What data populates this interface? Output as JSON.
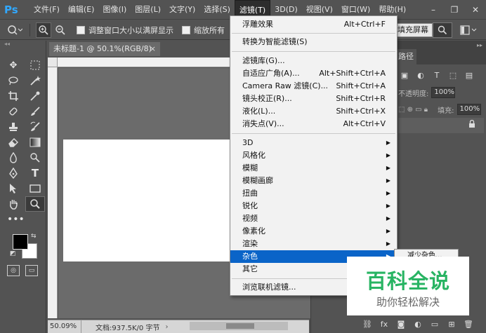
{
  "app": {
    "logo": "Ps"
  },
  "menubar": {
    "items": [
      "文件(F)",
      "编辑(E)",
      "图像(I)",
      "图层(L)",
      "文字(Y)",
      "选择(S)",
      "滤镜(T)",
      "3D(D)",
      "视图(V)",
      "窗口(W)",
      "帮助(H)"
    ],
    "active_index": 6
  },
  "window_controls": {
    "minimize": "–",
    "restore": "❐",
    "close": "✕"
  },
  "options": {
    "resize_windows_label": "调整窗口大小以满屏显示",
    "zoom_all_label": "缩放所有",
    "fill_screen_label": "填充屏幕"
  },
  "document": {
    "tab_title": "未标题-1 @ 50.1%(RGB/8)",
    "tab_close": "×"
  },
  "status": {
    "zoom": "50.09%",
    "info": "文档:937.5K/0 字节",
    "arrow": "›"
  },
  "panel": {
    "tab_label": "路径",
    "opacity_label": "不透明度:",
    "opacity_value": "100%",
    "fill_label": "填充:",
    "fill_value": "100%"
  },
  "filter_menu": {
    "items": [
      {
        "label": "浮雕效果",
        "shortcut": "Alt+Ctrl+F"
      },
      {
        "label": "转换为智能滤镜(S)",
        "shortcut": ""
      },
      {
        "label": "滤镜库(G)...",
        "shortcut": ""
      },
      {
        "label": "自适应广角(A)...",
        "shortcut": "Alt+Shift+Ctrl+A"
      },
      {
        "label": "Camera Raw 滤镜(C)...",
        "shortcut": "Shift+Ctrl+A"
      },
      {
        "label": "镜头校正(R)...",
        "shortcut": "Shift+Ctrl+R"
      },
      {
        "label": "液化(L)...",
        "shortcut": "Shift+Ctrl+X"
      },
      {
        "label": "消失点(V)...",
        "shortcut": "Alt+Ctrl+V"
      },
      {
        "label": "3D",
        "submenu": true
      },
      {
        "label": "风格化",
        "submenu": true
      },
      {
        "label": "模糊",
        "submenu": true
      },
      {
        "label": "模糊画廊",
        "submenu": true
      },
      {
        "label": "扭曲",
        "submenu": true
      },
      {
        "label": "锐化",
        "submenu": true
      },
      {
        "label": "视频",
        "submenu": true
      },
      {
        "label": "像素化",
        "submenu": true
      },
      {
        "label": "渲染",
        "submenu": true
      },
      {
        "label": "杂色",
        "submenu": true,
        "highlighted": true
      },
      {
        "label": "其它",
        "submenu": true
      },
      {
        "label": "浏览联机滤镜...",
        "shortcut": ""
      }
    ],
    "submenu_arrow": "▶"
  },
  "noise_submenu": {
    "first_item": "减少杂色..."
  },
  "watermark": {
    "title": "百科全说",
    "subtitle": "助你轻松解决"
  },
  "colors": {
    "menu_highlight": "#0a64c8",
    "ps_blue": "#31a8ff",
    "watermark_green": "#28b463"
  }
}
